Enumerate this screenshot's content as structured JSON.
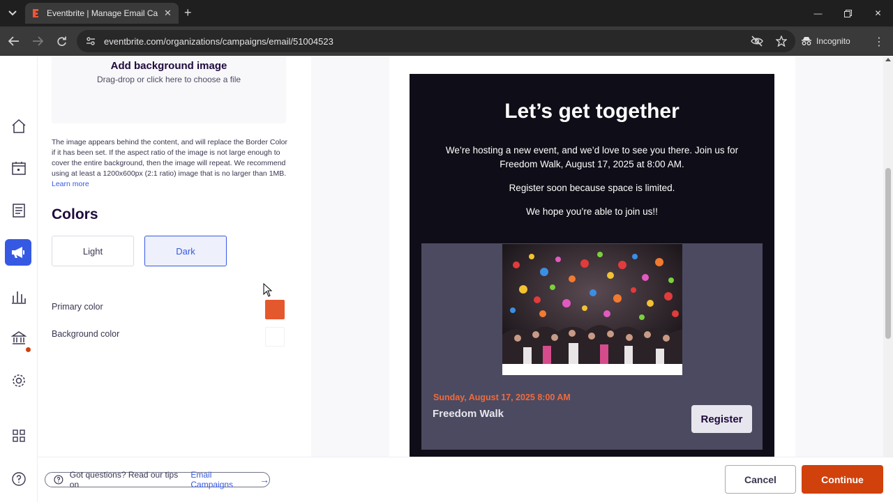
{
  "browser": {
    "tab_title": "Eventbrite | Manage Email Campaigns",
    "url": "eventbrite.com/organizations/campaigns/email/51004523",
    "incognito_label": "Incognito",
    "colors": {
      "tabbar": "#1f1f1f",
      "toolbar": "#3a3a3a"
    }
  },
  "sidebar": {
    "items": [
      {
        "icon": "home-icon"
      },
      {
        "icon": "calendar-icon"
      },
      {
        "icon": "orders-icon"
      },
      {
        "icon": "megaphone-icon",
        "active": true
      },
      {
        "icon": "reports-icon"
      },
      {
        "icon": "finance-icon",
        "badge": true
      },
      {
        "icon": "gear-icon"
      },
      {
        "icon": "apps-icon"
      },
      {
        "icon": "help-icon"
      }
    ]
  },
  "panel": {
    "dropzone_title": "Add background image",
    "dropzone_sub": "Drag-drop or click here to choose a file",
    "help_text": "The image appears behind the content, and will replace the Border Color if it has been set. If the aspect ratio of the image is not large enough to cover the entire background, then the image will repeat. We recommend using at least a 1200x600px (2:1 ratio) image that is no larger than 1MB.",
    "learn_more": "Learn more",
    "colors_heading": "Colors",
    "theme_light": "Light",
    "theme_dark": "Dark",
    "selected_theme": "Dark",
    "primary_color_label": "Primary color",
    "primary_color": "#e4582e",
    "background_color_label": "Background color",
    "background_color": "#ffffff"
  },
  "email": {
    "heading": "Let’s get together",
    "para1": "We’re hosting a new event, and we’d love to see you there. Join us for Freedom Walk, August 17, 2025 at 8:00 AM.",
    "para2": "Register soon because space is limited.",
    "para3": "We hope you’re able to join us!!",
    "event_date": "Sunday, August 17, 2025 8:00 AM",
    "event_title": "Freedom Walk",
    "register_label": "Register",
    "background": "#0f0d17",
    "card_color": "#4b4a60"
  },
  "footer": {
    "tips_prefix": "Got questions? Read our tips on",
    "tips_link": "Email Campaigns",
    "cancel_label": "Cancel",
    "continue_label": "Continue"
  }
}
